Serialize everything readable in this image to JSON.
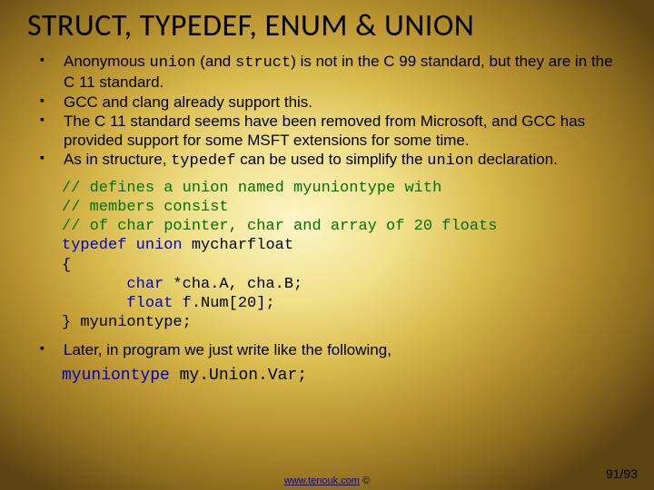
{
  "title": "STRUCT, TYPEDEF, ENUM & UNION",
  "bullets": {
    "b1a": "Anonymous ",
    "b1_union": "union",
    "b1b": " (and ",
    "b1_struct": "struct",
    "b1c": ") is not in the C 99 standard, but they are in the C 11 standard.",
    "b2": "GCC and clang already support this.",
    "b3": "The C 11 standard seems have been removed from Microsoft, and GCC has provided support for some MSFT extensions for some time.",
    "b4a": "As in structure, ",
    "b4_typedef": "typedef",
    "b4b": " can be used to simplify the ",
    "b4_union": "union",
    "b4c": " declaration."
  },
  "code": {
    "c1": "// defines a union named myuniontype with",
    "c2": "// members consist",
    "c3": "// of char pointer, char and array of 20 floats",
    "kw_typedef": "typedef",
    "kw_union": "union",
    "name": " mycharfloat",
    "brace_open": "{",
    "line_char": "       char",
    "line_char_rest": " *cha.A, cha.B;",
    "line_float": "       float",
    "line_float_rest": " f.Num[20];",
    "brace_close": "} myuniontype;"
  },
  "later": "Later, in program we just write like the following,",
  "usage": {
    "type": "myuniontype",
    "var": " my.Union.Var;"
  },
  "footer": {
    "link": "www.tenouk.com",
    "copy": " ©"
  },
  "page": "91/93"
}
